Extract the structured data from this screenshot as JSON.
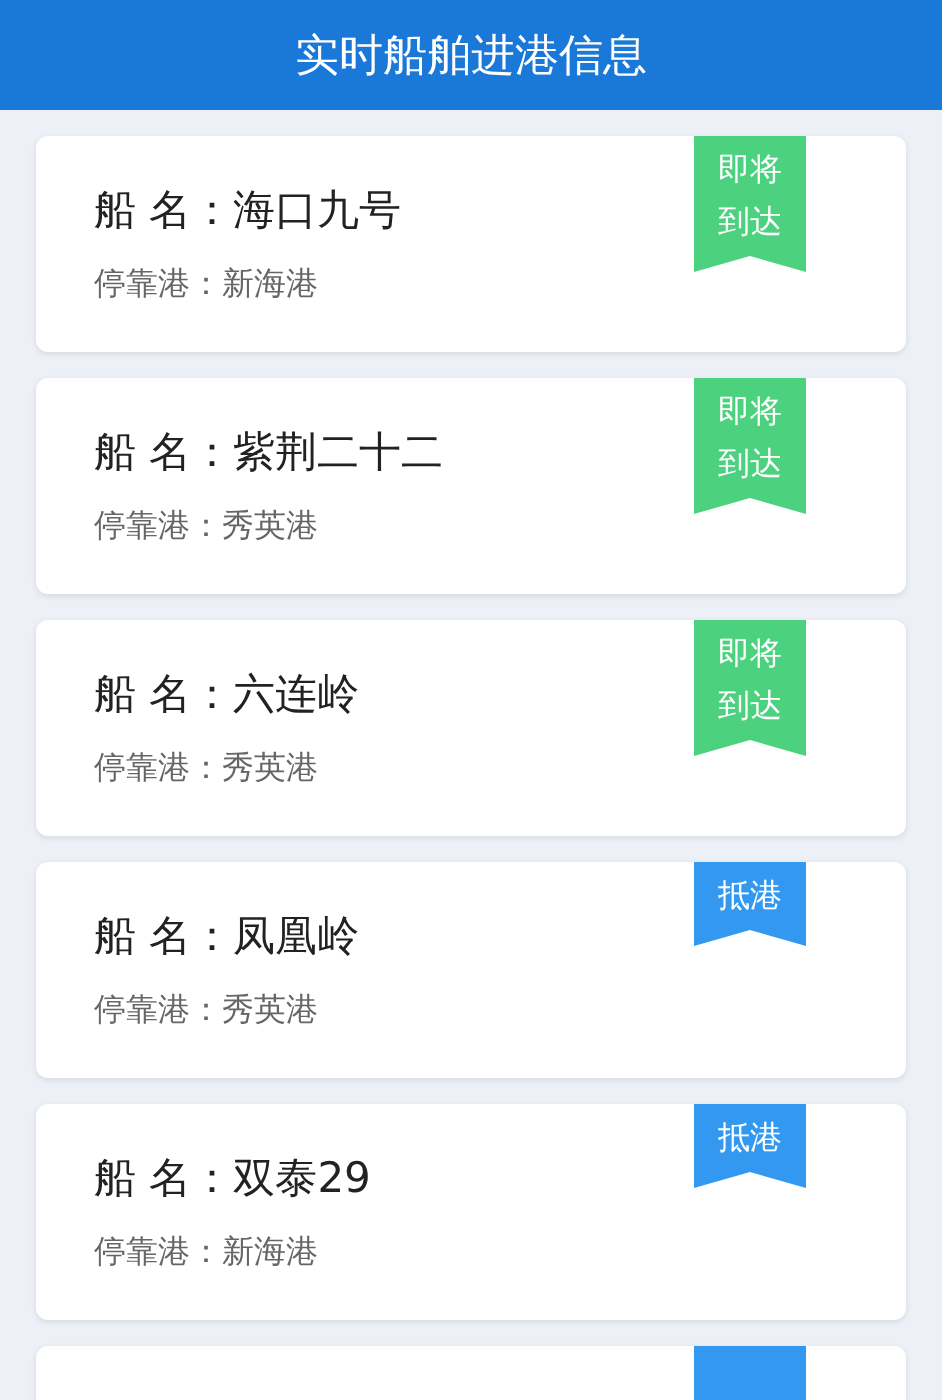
{
  "header": {
    "title": "实时船舶进港信息"
  },
  "ships": [
    {
      "name_label": "船 名：",
      "name": "海口九号",
      "port_label": "停靠港：",
      "port": "新海港",
      "status": "即将到达",
      "color": "#4cd17f"
    },
    {
      "name_label": "船 名：",
      "name": "紫荆二十二",
      "port_label": "停靠港：",
      "port": "秀英港",
      "status": "即将到达",
      "color": "#4cd17f"
    },
    {
      "name_label": "船 名：",
      "name": "六连岭",
      "port_label": "停靠港：",
      "port": "秀英港",
      "status": "即将到达",
      "color": "#4cd17f"
    },
    {
      "name_label": "船 名：",
      "name": "凤凰岭",
      "port_label": "停靠港：",
      "port": "秀英港",
      "status": "抵港",
      "color": "#3399f0"
    },
    {
      "name_label": "船 名：",
      "name": "双泰29",
      "port_label": "停靠港：",
      "port": "新海港",
      "status": "抵港",
      "color": "#3399f0"
    },
    {
      "color": "#3399f0"
    }
  ]
}
